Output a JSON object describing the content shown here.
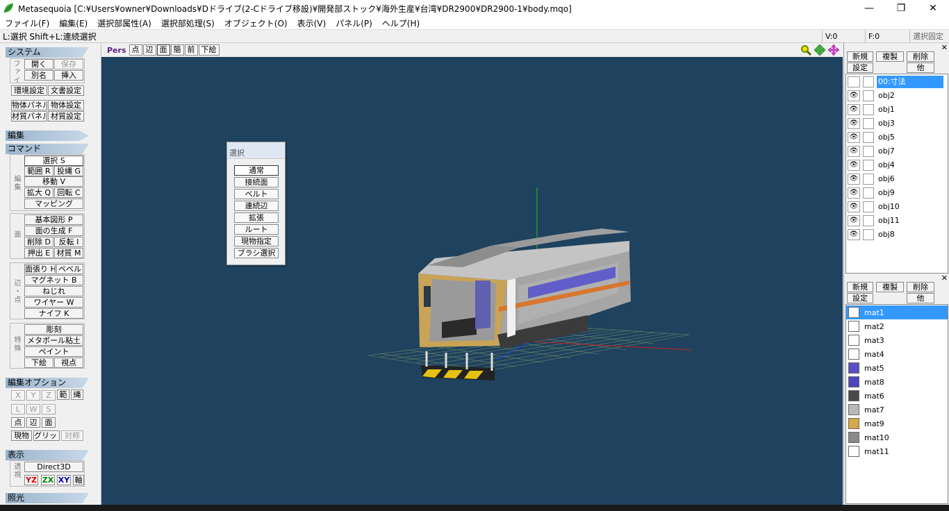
{
  "window": {
    "title": "Metasequoia [C:¥Users¥owner¥Downloads¥Dドライブ(2-Cドライブ移設)¥開発部ストック¥海外生産¥台湾¥DR2900¥DR2900-1¥body.mqo]",
    "minimize": "—",
    "maximize": "❐",
    "close": "✕"
  },
  "menu": [
    "ファイル(F)",
    "編集(E)",
    "選択部属性(A)",
    "選択部処理(S)",
    "オブジェクト(O)",
    "表示(V)",
    "パネル(P)",
    "ヘルプ(H)"
  ],
  "status": {
    "hint": "L:選択  Shift+L:連続選択",
    "v": "V:0",
    "f": "F:0",
    "lock": "選択固定"
  },
  "left": {
    "system": "システム",
    "file_label": "ファイル",
    "open": "開く",
    "save": "保存",
    "saveas": "別名",
    "insert": "挿入",
    "env": "環境設定",
    "doc": "文書設定",
    "objpanel": "物体パネル",
    "objset": "物体設定",
    "matpanel": "材質パネル",
    "matset": "材質設定",
    "edit": "編集",
    "command": "コマンド",
    "edit_label": "編集",
    "select": "選択 S",
    "range": "範囲 R",
    "lasso": "投縄 G",
    "move": "移動 V",
    "scale": "拡大 Q",
    "rotate": "回転 C",
    "mapping": "マッピング",
    "face_label": "面",
    "prim": "基本図形 P",
    "genface": "面の生成 F",
    "del": "削除 D",
    "flip": "反転 I",
    "extrude": "押出 E",
    "material": "材質 M",
    "edgept_label": "辺・点",
    "facet": "面張り H",
    "bevel": "ベベル",
    "magnet": "マグネット B",
    "twist": "ねじれ",
    "wire": "ワイヤー W",
    "knife": "ナイフ K",
    "special_label": "特殊",
    "sculpt": "彫刻",
    "metaball": "メタボール粘土",
    "paint": "ペイント",
    "underlay": "下絵",
    "viewpt": "視点",
    "editopt": "編集オプション",
    "x": "X",
    "y": "Y",
    "z": "Z",
    "rng": "範",
    "rope": "縄",
    "l": "L",
    "w": "W",
    "s": "S",
    "pt": "点",
    "edge": "辺",
    "face": "面",
    "current": "現物",
    "grid": "グリッド",
    "sym": "対称",
    "display": "表示",
    "persp_label": "透視",
    "d3d": "Direct3D",
    "yz": "YZ",
    "zx": "ZX",
    "xy": "XY",
    "axis": "軸",
    "light": "照光"
  },
  "vptoolbar": {
    "pers": "Pers",
    "pt": "点",
    "edge": "辺",
    "face": "面",
    "simple": "簡",
    "front": "前",
    "underlay": "下絵"
  },
  "selpanel": {
    "title": "選択",
    "buttons": [
      "通常",
      "接続面",
      "ベルト",
      "連続辺",
      "拡張",
      "ルート",
      "現物指定",
      "ブラシ選択"
    ]
  },
  "objpanel": {
    "new": "新規",
    "dup": "複製",
    "del": "削除",
    "settings": "設定",
    "other": "他",
    "objects": [
      "00:寸法",
      "obj2",
      "obj1",
      "obj3",
      "obj5",
      "obj7",
      "obj4",
      "obj6",
      "obj9",
      "obj10",
      "obj11",
      "obj8"
    ]
  },
  "matpanel": {
    "new": "新規",
    "dup": "複製",
    "del": "削除",
    "settings": "設定",
    "other": "他",
    "materials": [
      {
        "name": "mat1",
        "color": "#ffffff"
      },
      {
        "name": "mat2",
        "color": "#ffffff"
      },
      {
        "name": "mat3",
        "color": "#ffffff"
      },
      {
        "name": "mat4",
        "color": "#ffffff"
      },
      {
        "name": "mat5",
        "color": "#5a4fc8"
      },
      {
        "name": "mat8",
        "color": "#4a46c0"
      },
      {
        "name": "mat6",
        "color": "#4a4a4a"
      },
      {
        "name": "mat7",
        "color": "#b8b8b8"
      },
      {
        "name": "mat9",
        "color": "#d4a94a"
      },
      {
        "name": "mat10",
        "color": "#8a8a8a"
      },
      {
        "name": "mat11",
        "color": "#ffffff"
      }
    ]
  },
  "colors": {
    "viewport_bg": "#1f425e",
    "selection": "#3399ff",
    "pers": "#5a1f7a"
  }
}
